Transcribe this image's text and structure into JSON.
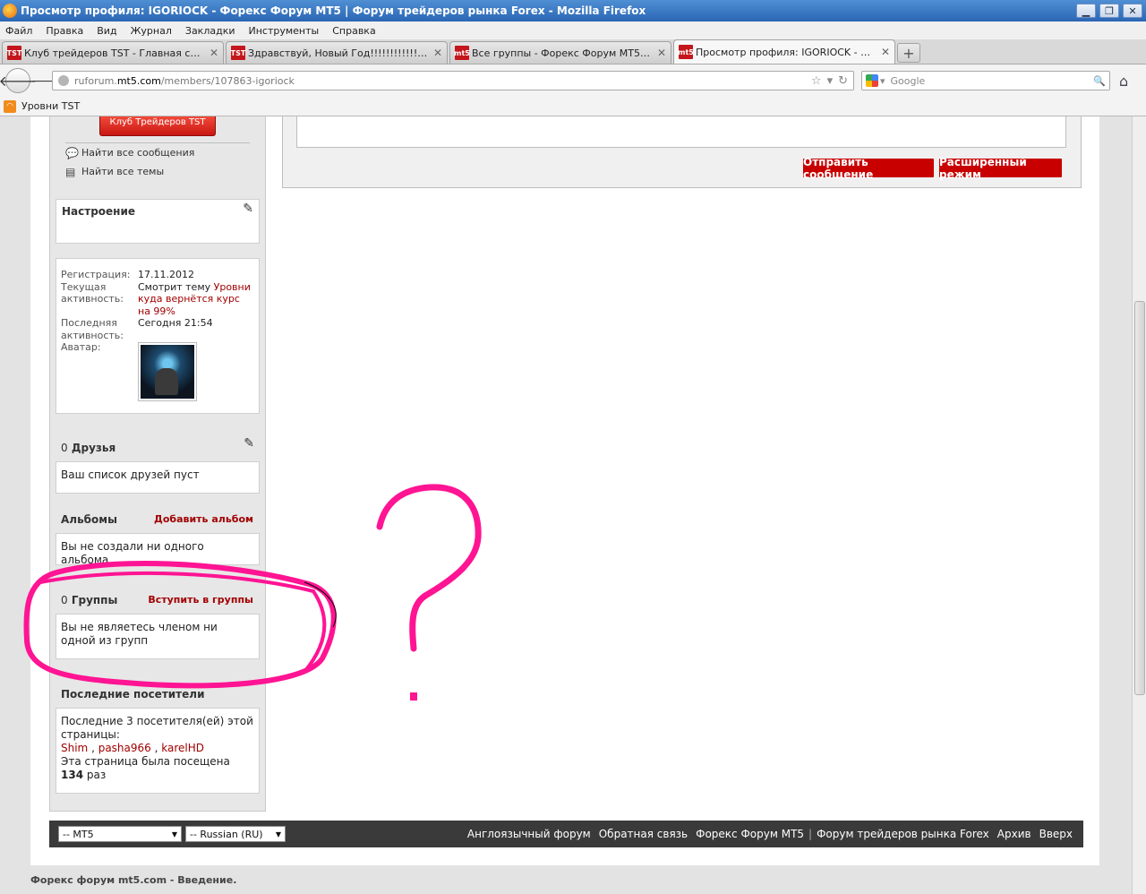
{
  "window": {
    "title": "Просмотр профиля: IGORIOCK - Форекс Форум MT5 | Форум трейдеров рынка Forex - Mozilla Firefox"
  },
  "menu": [
    "Файл",
    "Правка",
    "Вид",
    "Журнал",
    "Закладки",
    "Инструменты",
    "Справка"
  ],
  "tabs": [
    {
      "favicon": "TST",
      "label": "Клуб трейдеров TST - Главная стран..."
    },
    {
      "favicon": "TST",
      "label": "Здравствуй, Новый Год!!!!!!!!!!!!!!!"
    },
    {
      "favicon": "mt5",
      "label": "Все группы - Форекс Форум MT5 | Фор..."
    },
    {
      "favicon": "mt5",
      "label": "Просмотр профиля: IGORIOCK - Форек..."
    }
  ],
  "nav": {
    "url_prefix": "ruforum.",
    "url_domain": "mt5.com",
    "url_path": "/members/107863-igoriock",
    "search_placeholder": "Google"
  },
  "bookmarks": [
    "Уровни TST"
  ],
  "sidebar": {
    "tst_button": "Клуб Трейдеров TST",
    "find_posts": "Найти все сообщения",
    "find_threads": "Найти все темы",
    "mood_title": "Настроение",
    "info": {
      "reg_label": "Регистрация:",
      "reg_value": "17.11.2012",
      "activity_label": "Текущая активность:",
      "activity_prefix": "Смотрит тему",
      "activity_link": "Уровни куда вернётся курс на 99%",
      "last_label": "Последняя активность:",
      "last_value": "Сегодня 21:54",
      "avatar_label": "Аватар:"
    },
    "friends": {
      "count": "0",
      "title": "Друзья",
      "empty": "Ваш список друзей пуст"
    },
    "albums": {
      "title": "Альбомы",
      "add": "Добавить альбом",
      "empty": "Вы не создали ни одного альбома"
    },
    "groups": {
      "count": "0",
      "title": "Группы",
      "join": "Вступить в группы",
      "empty": "Вы не являетесь членом ни одной из групп"
    },
    "visitors": {
      "title": "Последние посетители",
      "intro": "Последние 3 посетителя(ей) этой страницы:",
      "names": [
        "Shim",
        "pasha966",
        "karelHD"
      ],
      "visited_prefix": "Эта страница была посещена",
      "visited_count": "134",
      "visited_suffix": "раз"
    }
  },
  "composer": {
    "send": "Отправить сообщение",
    "advanced": "Расширенный режим"
  },
  "footer": {
    "style_select": "-- MT5",
    "lang_select": "-- Russian (RU)",
    "links": [
      "Англоязычный форум",
      "Обратная связь",
      "Форекс Форум MT5",
      "Форум трейдеров рынка Forex",
      "Архив",
      "Вверх"
    ]
  },
  "copyright": "Форекс форум mt5.com - Введение.",
  "colors": {
    "accent_red": "#c80000",
    "link_red": "#a10000",
    "annotation_pink": "#ff1493"
  }
}
